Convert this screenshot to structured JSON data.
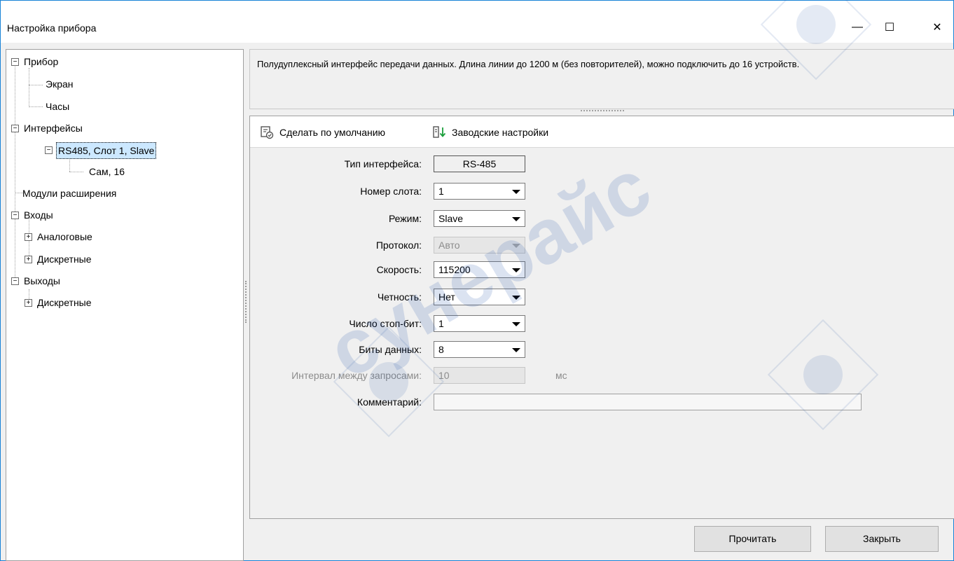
{
  "window": {
    "title": "Настройка прибора",
    "controls": {
      "minimize": "—",
      "maximize": "☐",
      "close": "✕"
    }
  },
  "tree": {
    "items": [
      {
        "label": "Прибор",
        "toggle": "−"
      },
      {
        "label": "Экран"
      },
      {
        "label": "Часы"
      },
      {
        "label": "Интерфейсы",
        "toggle": "−"
      },
      {
        "label": "RS485, Слот 1, Slave",
        "toggle": "−",
        "selected": true
      },
      {
        "label": "Сам, 16"
      },
      {
        "label": "Модули расширения"
      },
      {
        "label": "Входы",
        "toggle": "−"
      },
      {
        "label": "Аналоговые",
        "toggle": "+"
      },
      {
        "label": "Дискретные",
        "toggle": "+"
      },
      {
        "label": "Выходы",
        "toggle": "−"
      },
      {
        "label": "Дискретные",
        "toggle": "+"
      }
    ]
  },
  "description": {
    "text": "Полудуплексный интерфейс передачи данных. Длина линии до 1200 м (без повторителей), можно подключить до 16 устройств."
  },
  "toolbar": {
    "default_label": "Сделать по умолчанию",
    "factory_label": "Заводские настройки"
  },
  "form": {
    "interface_type": {
      "label": "Тип интерфейса:",
      "value": "RS-485"
    },
    "slot": {
      "label": "Номер слота:",
      "value": "1"
    },
    "mode": {
      "label": "Режим:",
      "value": "Slave"
    },
    "protocol": {
      "label": "Протокол:",
      "value": "Авто"
    },
    "speed": {
      "label": "Скорость:",
      "value": "115200"
    },
    "parity": {
      "label": "Четность:",
      "value": "Нет"
    },
    "stop_bits": {
      "label": "Число стоп-бит:",
      "value": "1"
    },
    "data_bits": {
      "label": "Биты данных:",
      "value": "8"
    },
    "interval": {
      "label": "Интервал между запросами:",
      "value": "10",
      "unit": "мс"
    },
    "comment": {
      "label": "Комментарий:",
      "value": ""
    }
  },
  "buttons": {
    "read": "Прочитать",
    "close": "Закрыть"
  },
  "watermark": {
    "text": "сунерайс",
    "color": "#1f4fa8"
  }
}
